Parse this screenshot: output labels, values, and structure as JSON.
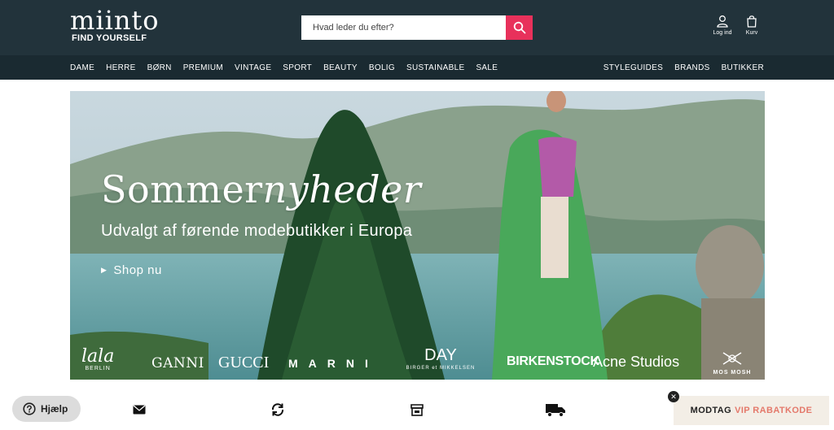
{
  "header": {
    "logo_word": "miinto",
    "logo_tagline": "FIND YOURSELF",
    "search": {
      "placeholder": "Hvad leder du efter?",
      "value": ""
    },
    "login_label": "Log ind",
    "cart_label": "Kurv"
  },
  "nav": {
    "left": [
      "DAME",
      "HERRE",
      "BØRN",
      "PREMIUM",
      "VINTAGE",
      "SPORT",
      "BEAUTY",
      "BOLIG",
      "SUSTAINABLE",
      "SALE"
    ],
    "right": [
      "STYLEGUIDES",
      "BRANDS",
      "BUTIKKER"
    ]
  },
  "hero": {
    "title_regular": "Sommer",
    "title_italic": "nyheder",
    "subtitle": "Udvalgt af førende modebutikker i Europa",
    "cta": "Shop nu",
    "brands": {
      "lala": "lala",
      "lala_sub": "BERLIN",
      "ganni": "GANNI",
      "gucci": "GUCCI",
      "marni": "MARNI",
      "day": "DAY",
      "day_sub": "BIRGER et MIKKELSEN",
      "birkenstock": "BIRKENSTOCK",
      "acne": "Acne Studios",
      "mos": "MOS MOSH"
    }
  },
  "footer_bar": {
    "help_label": "Hjælp",
    "usp_icons": [
      "mail-icon",
      "refresh-icon",
      "store-icon",
      "truck-icon"
    ],
    "vip_text": "MODTAG",
    "vip_accent": "VIP RABATKODE",
    "close_symbol": "✕"
  },
  "colors": {
    "header_bg": "#22333b",
    "nav_bg": "#1a2a31",
    "search_button": "#e8315b",
    "vip_accent": "#e4796b",
    "vip_bg": "#f3eee6"
  }
}
